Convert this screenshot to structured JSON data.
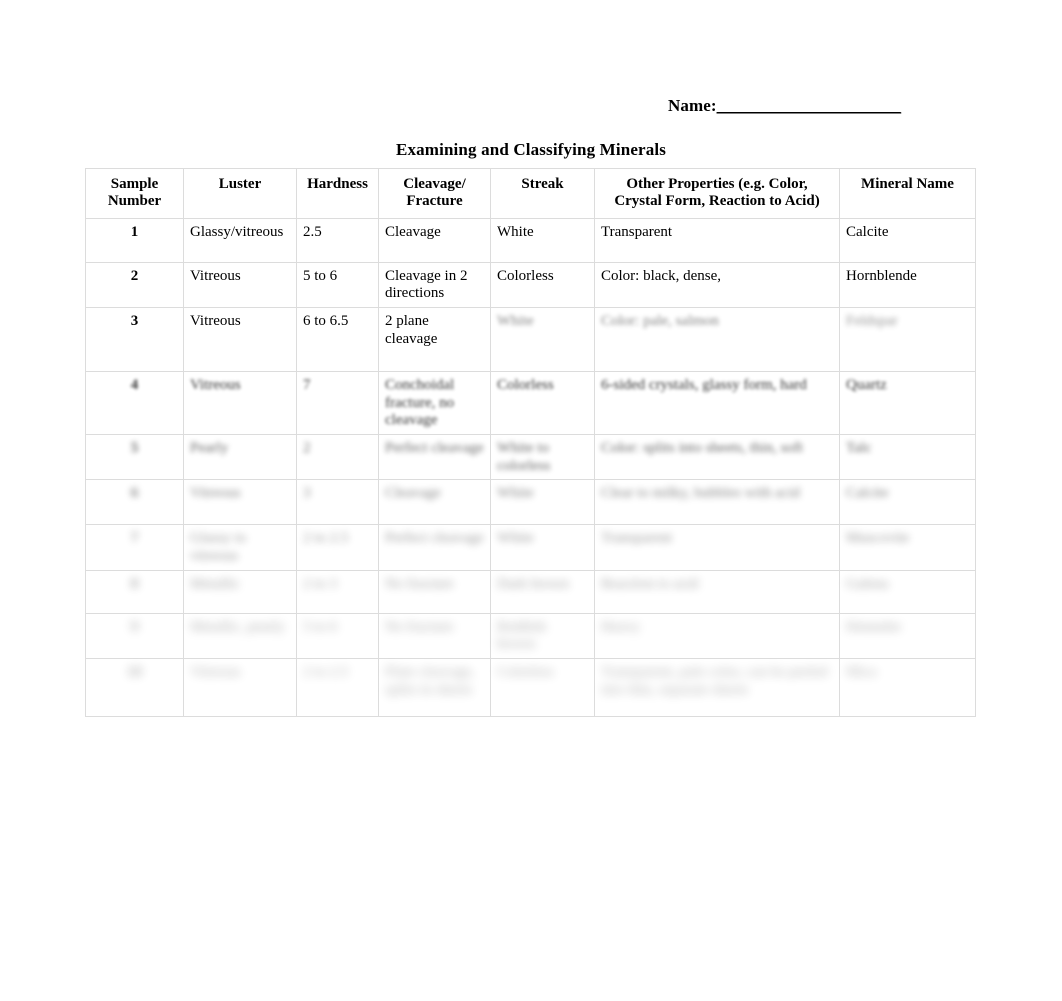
{
  "header": {
    "name_label": "Name:",
    "name_blank": "_______________________"
  },
  "title": "Examining and Classifying Minerals",
  "table": {
    "columns": [
      "Sample Number",
      "Luster",
      "Hardness",
      "Cleavage/ Fracture",
      "Streak",
      "Other Properties (e.g. Color, Crystal Form, Reaction to Acid)",
      "Mineral Name"
    ],
    "column_lines": {
      "sample": [
        "Sample",
        "Number"
      ],
      "luster": [
        "Luster"
      ],
      "hardness": [
        "Hardness"
      ],
      "cleavage": [
        "Cleavage/",
        "Fracture"
      ],
      "streak": [
        "Streak"
      ],
      "other": [
        "Other Properties (e.g. Color,",
        "Crystal Form, Reaction to Acid)"
      ],
      "mineral": [
        "Mineral Name"
      ]
    },
    "rows": [
      {
        "sample": "1",
        "luster": "Glassy/vitreous",
        "hardness": "2.5",
        "cleavage": "Cleavage",
        "streak": "White",
        "other": "Transparent",
        "mineral": "Calcite",
        "blur": "none"
      },
      {
        "sample": "2",
        "luster": "Vitreous",
        "hardness": "5 to 6",
        "cleavage": "Cleavage in 2 directions",
        "streak": "Colorless",
        "other": "Color: black, dense,",
        "mineral": "Hornblende",
        "blur": "none"
      },
      {
        "sample": "3",
        "luster": "Vitreous",
        "hardness": "6 to 6.5",
        "cleavage": "2 plane cleavage",
        "streak": "White",
        "other": "Color: pale, salmon",
        "mineral": "Feldspar",
        "blur": "partial"
      },
      {
        "sample": "4",
        "luster": "Vitreous",
        "hardness": "7",
        "cleavage": "Conchoidal fracture, no cleavage",
        "streak": "Colorless",
        "other": "6-sided crystals, glassy form, hard",
        "mineral": "Quartz",
        "blur": "1"
      },
      {
        "sample": "5",
        "luster": "Pearly",
        "hardness": "2",
        "cleavage": "Perfect cleavage",
        "streak": "White to colorless",
        "other": "Color: splits into sheets, thin, soft",
        "mineral": "Talc",
        "blur": "2"
      },
      {
        "sample": "6",
        "luster": "Vitreous",
        "hardness": "3",
        "cleavage": "Cleavage",
        "streak": "White",
        "other": "Clear to milky, bubbles with acid",
        "mineral": "Calcite",
        "blur": "3"
      },
      {
        "sample": "7",
        "luster": "Glassy to vitreous",
        "hardness": "2 to 2.5",
        "cleavage": "Perfect cleavage",
        "streak": "White",
        "other": "Transparent",
        "mineral": "Muscovite",
        "blur": "4"
      },
      {
        "sample": "8",
        "luster": "Metallic",
        "hardness": "2 to 3",
        "cleavage": "No fracture",
        "streak": "Dark brown",
        "other": "Reaction to acid",
        "mineral": "Galena",
        "blur": "5"
      },
      {
        "sample": "9",
        "luster": "Metallic, pearly",
        "hardness": "5 to 6",
        "cleavage": "No fracture",
        "streak": "Reddish brown",
        "other": "Heavy",
        "mineral": "Hematite",
        "blur": "6"
      },
      {
        "sample": "10",
        "luster": "Vitreous",
        "hardness": "2 to 2.5",
        "cleavage": "Plate cleavage, splits in sheets",
        "streak": "Colorless",
        "other": "Transparent, pale color, can be peeled into thin, separate sheets",
        "mineral": "Mica",
        "blur": "7"
      }
    ]
  }
}
